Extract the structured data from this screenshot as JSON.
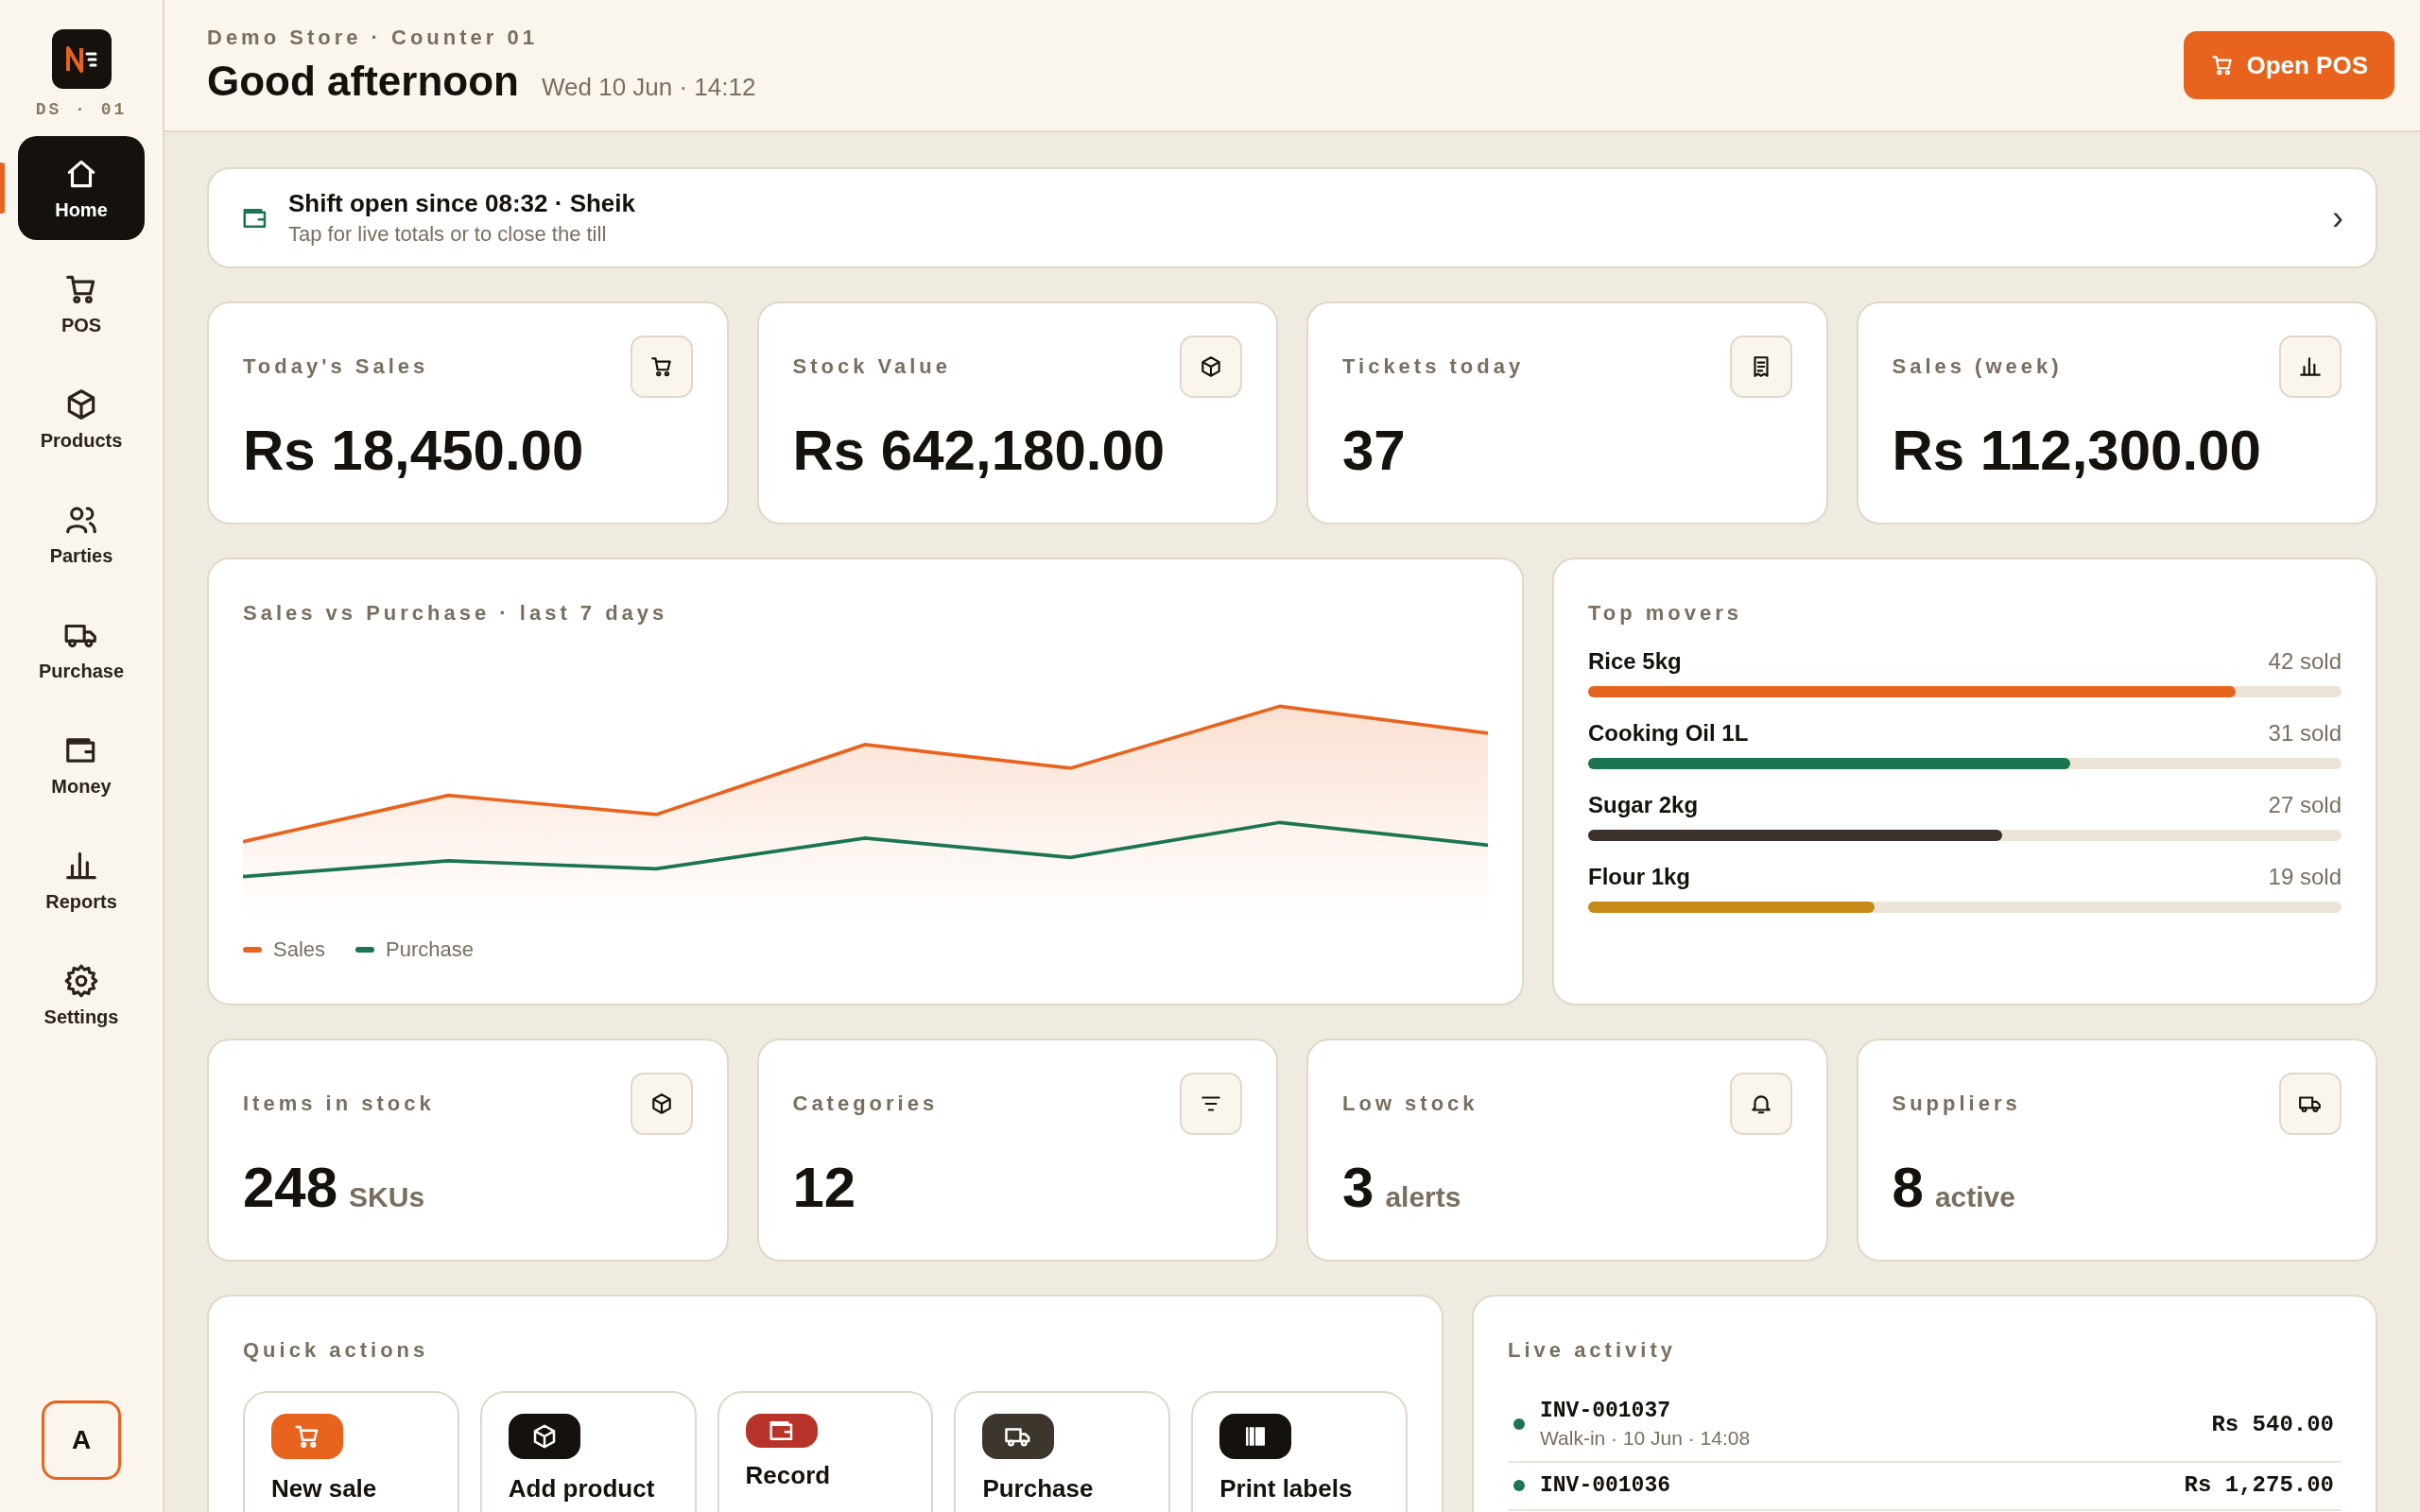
{
  "sidebar": {
    "logo_code": "DS · 01",
    "items": [
      {
        "label": "Home",
        "selected": true
      },
      {
        "label": "POS",
        "selected": false
      },
      {
        "label": "Products",
        "selected": false
      },
      {
        "label": "Parties",
        "selected": false
      },
      {
        "label": "Purchase",
        "selected": false
      },
      {
        "label": "Money",
        "selected": false
      },
      {
        "label": "Reports",
        "selected": false
      },
      {
        "label": "Settings",
        "selected": false
      }
    ],
    "avatar": "A"
  },
  "header": {
    "store": "Demo Store · Counter 01",
    "greeting": "Good afternoon",
    "datetime": "Wed 10 Jun · 14:12",
    "button": "Open POS"
  },
  "shift": {
    "title": "Shift open since 08:32 · Sheik",
    "subtitle": "Tap for live totals or to close the till",
    "chevron": "›"
  },
  "stats": [
    {
      "label": "Today's Sales",
      "value": "Rs 18,450.00"
    },
    {
      "label": "Stock Value",
      "value": "Rs 642,180.00"
    },
    {
      "label": "Tickets today",
      "value": "37"
    },
    {
      "label": "Sales (week)",
      "value": "Rs 112,300.00"
    }
  ],
  "sales_chart": {
    "title": "Sales vs Purchase · last 7 days",
    "legend": [
      {
        "name": "Sales",
        "color": "#e8641e"
      },
      {
        "name": "Purchase",
        "color": "#1a7550"
      }
    ]
  },
  "top_movers": {
    "title": "Top movers",
    "items": [
      {
        "name": "Rice 5kg",
        "sold": "42 sold",
        "level": 0.86,
        "color": "#e8641e"
      },
      {
        "name": "Cooking Oil 1L",
        "sold": "31 sold",
        "level": 0.64,
        "color": "#1a7550"
      },
      {
        "name": "Sugar 2kg",
        "sold": "27 sold",
        "level": 0.55,
        "color": "#3a322a"
      },
      {
        "name": "Flour 1kg",
        "sold": "19 sold",
        "level": 0.38,
        "color": "#c68a17"
      }
    ]
  },
  "inventory_stats": [
    {
      "label": "Items in stock",
      "value": "248",
      "unit": "SKUs"
    },
    {
      "label": "Categories",
      "value": "12"
    },
    {
      "label": "Low stock",
      "value": "3",
      "unit": "alerts"
    },
    {
      "label": "Suppliers",
      "value": "8",
      "unit": "active"
    }
  ],
  "quick_actions": {
    "title": "Quick actions",
    "items": [
      {
        "label": "New sale",
        "color": "#e8641e"
      },
      {
        "label": "Add product",
        "color": "#15110c"
      },
      {
        "label": "Record",
        "color": "#b8342a"
      },
      {
        "label": "Purchase",
        "color": "#3d362c"
      },
      {
        "label": "Print labels",
        "color": "#15110c"
      }
    ]
  },
  "live_activity": {
    "title": "Live activity",
    "items": [
      {
        "invoice": "INV-001037",
        "detail": "Walk-in · 10 Jun · 14:08",
        "amount": "Rs 540.00",
        "color": "#1a7550"
      },
      {
        "invoice": "INV-001036",
        "amount": "Rs 1,275.00",
        "color": "#1a7550"
      }
    ]
  }
}
